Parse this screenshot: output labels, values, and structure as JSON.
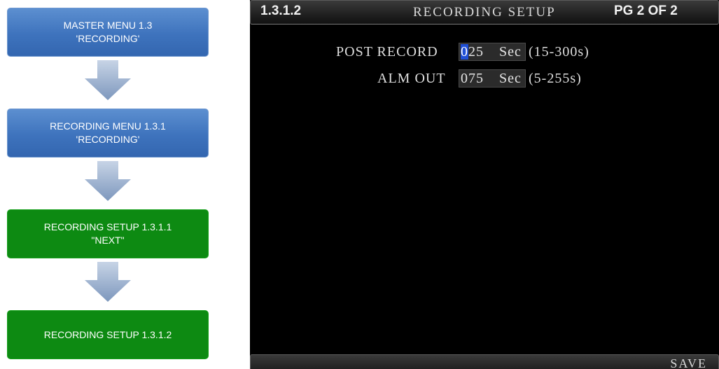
{
  "flow": {
    "steps": [
      {
        "line1": "MASTER MENU 1.3",
        "line2": "'RECORDING'"
      },
      {
        "line1": "RECORDING MENU 1.3.1",
        "line2": "'RECORDING'"
      },
      {
        "line1": "RECORDING SETUP 1.3.1.1",
        "line2": "\"NEXT\""
      },
      {
        "line1": "RECORDING SETUP 1.3.1.2"
      }
    ],
    "colors": {
      "blue": "#3e73bd",
      "green": "#0d8a12",
      "arrow": "#8ea9cc"
    }
  },
  "screen": {
    "menu_id": "1.3.1.2",
    "title": "RECORDING SETUP",
    "page": "PG 2 OF 2",
    "fields": {
      "post_record": {
        "label": "POST RECORD",
        "value_cursor": "0",
        "value_rest": "25",
        "unit": "Sec",
        "range": "(15-300s)"
      },
      "alm_out": {
        "label": "ALM OUT",
        "value": "075",
        "unit": "Sec",
        "range": "(5-255s)"
      }
    },
    "save_label": "SAVE",
    "cursor_color": "#1f4fd6"
  }
}
